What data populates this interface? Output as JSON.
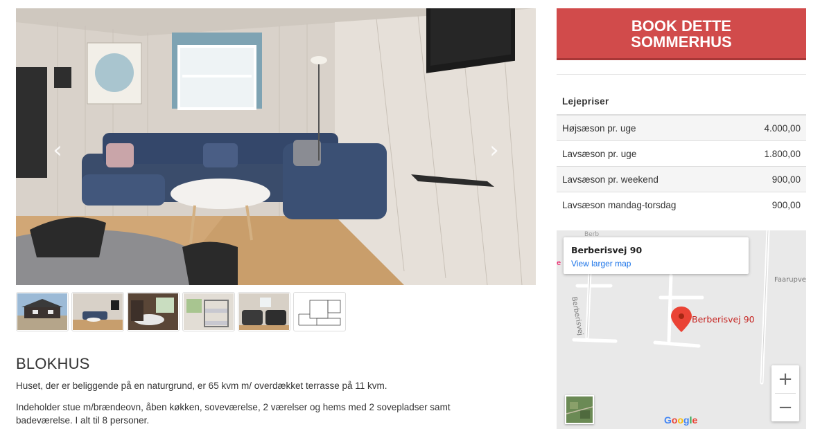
{
  "gallery": {
    "prev_arrow": "‹",
    "next_arrow": "›",
    "thumbnails": [
      {
        "icon": "house-exterior-photo"
      },
      {
        "icon": "living-room-photo"
      },
      {
        "icon": "kitchen-photo"
      },
      {
        "icon": "bunk-room-photo"
      },
      {
        "icon": "bedroom-photo"
      },
      {
        "icon": "floor-plan-image"
      }
    ]
  },
  "listing": {
    "title": "BLOKHUS",
    "paragraph1": "Huset, der er beliggende på en naturgrund, er 65 kvm m/ overdækket terrasse på 11 kvm.",
    "paragraph2": "Indeholder stue m/brændeovn, åben køkken, soveværelse, 2 værelser  og hems med 2 sovepladser samt badeværelse. I alt til 8 personer."
  },
  "booking": {
    "button_line1": "BOOK DETTE",
    "button_line2": "SOMMERHUS",
    "color": "#d14b4b"
  },
  "prices": {
    "header": "Lejepriser",
    "rows": [
      {
        "label": "Højsæson pr. uge",
        "value": "4.000,00"
      },
      {
        "label": "Lavsæson pr. uge",
        "value": "1.800,00"
      },
      {
        "label": "Lavsæson pr. weekend",
        "value": "900,00"
      },
      {
        "label": "Lavsæson mandag-torsdag",
        "value": "900,00"
      }
    ]
  },
  "map": {
    "card_title": "Berberisvej 90",
    "card_link": "View larger map",
    "pin_label": "Berberisvej 90",
    "street_a": "Berberisvej",
    "street_b": "Faarupvej",
    "street_c": "Berb",
    "zoom_in": "+",
    "zoom_out": "−",
    "logo": [
      "G",
      "o",
      "o",
      "g",
      "l",
      "e"
    ],
    "pin_color": "#ea4335"
  }
}
